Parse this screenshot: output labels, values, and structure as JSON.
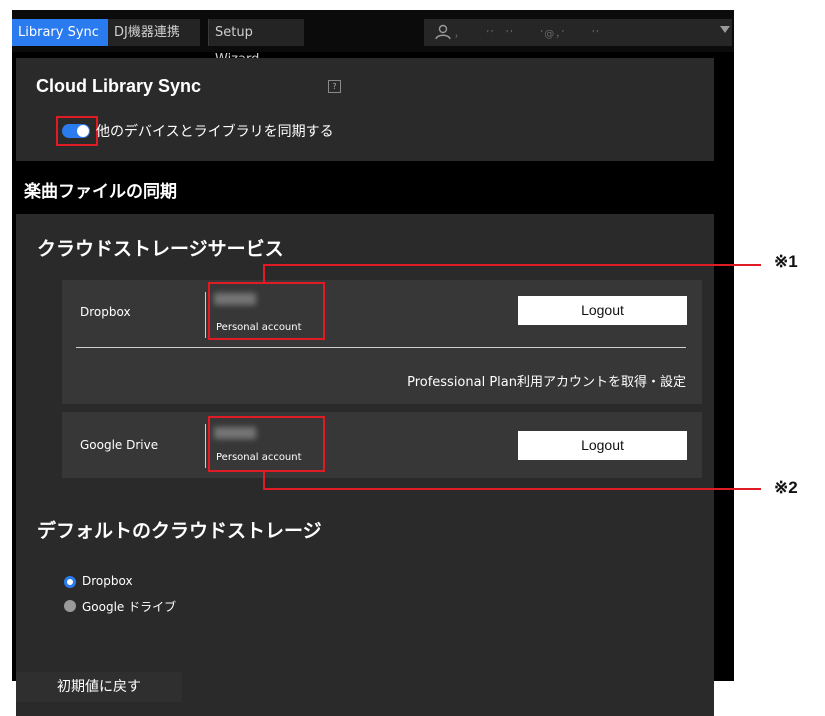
{
  "tabs": [
    {
      "label": "Library Sync",
      "active": true
    },
    {
      "label": "DJ機器連携",
      "active": false
    },
    {
      "label": "Setup Wizard",
      "active": false
    }
  ],
  "account_menu": {
    "icon": "person-icon",
    "masked": "，　　 ’’　’’　　 ’@，’　　 ’’"
  },
  "cloud_library_sync": {
    "title": "Cloud Library Sync",
    "help_label": "?",
    "toggle_on": true,
    "toggle_label": "他のデバイスとライブラリを同期する"
  },
  "music_file_sync_title": "楽曲ファイルの同期",
  "cloud_storage": {
    "heading": "クラウドストレージサービス",
    "services": [
      {
        "name": "Dropbox",
        "account_type": "Personal account",
        "logout_label": "Logout"
      },
      {
        "name": "Google Drive",
        "account_type": "Personal account",
        "logout_label": "Logout"
      }
    ],
    "professional_plan_link": "Professional Plan利用アカウントを取得・設定"
  },
  "default_storage": {
    "heading": "デフォルトのクラウドストレージ",
    "options": [
      {
        "label": "Dropbox",
        "selected": true
      },
      {
        "label": "Google ドライブ",
        "selected": false
      }
    ]
  },
  "reset_button": "初期値に戻す",
  "annotations": {
    "note1": "※1",
    "note2": "※2"
  },
  "colors": {
    "accent": "#2b7bf0",
    "highlight": "#e01b24",
    "panel": "#2a2a2a",
    "background": "#000000"
  }
}
